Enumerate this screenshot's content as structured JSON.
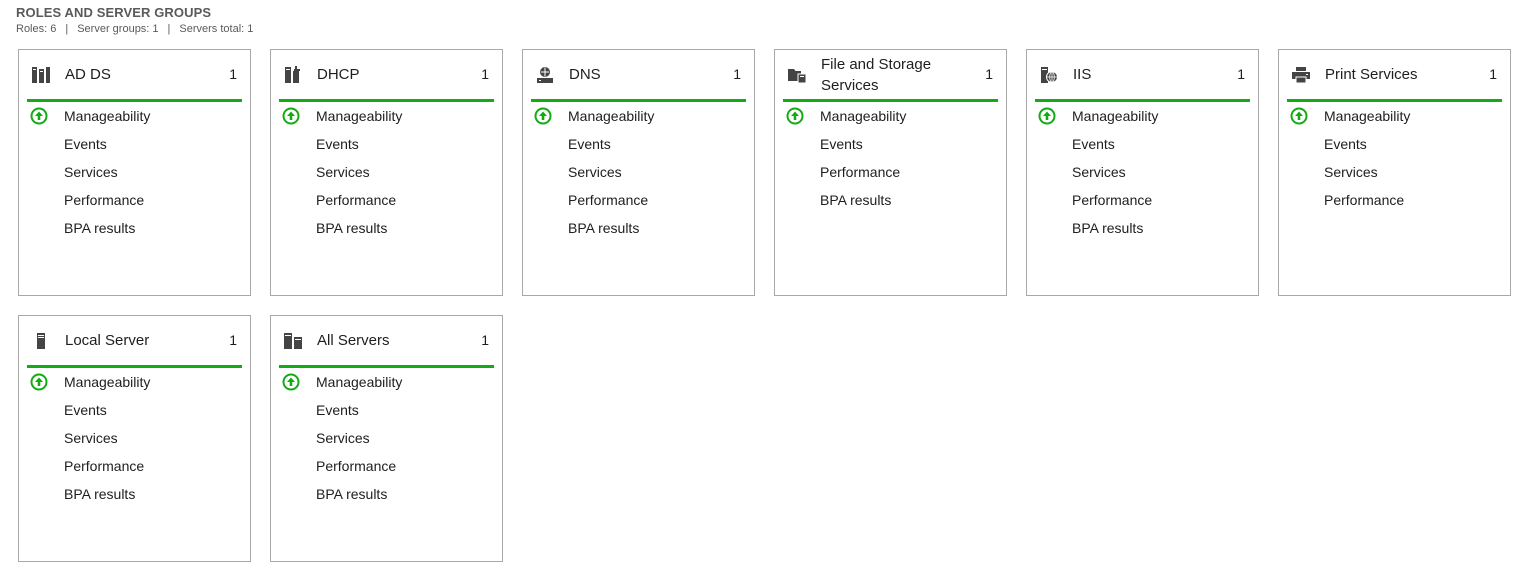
{
  "section": {
    "title": "ROLES AND SERVER GROUPS",
    "stats": {
      "roles": "Roles: 6",
      "groups": "Server groups: 1",
      "servers": "Servers total: 1",
      "separator": "|"
    }
  },
  "colors": {
    "accent_green": "#13ab13",
    "border": "#a9a9a9",
    "icon_gray": "#444444"
  },
  "tiles": [
    {
      "title": "AD DS",
      "count": "1",
      "icon": "ad-ds-icon",
      "items": [
        "Manageability",
        "Events",
        "Services",
        "Performance",
        "BPA results"
      ]
    },
    {
      "title": "DHCP",
      "count": "1",
      "icon": "dhcp-icon",
      "items": [
        "Manageability",
        "Events",
        "Services",
        "Performance",
        "BPA results"
      ]
    },
    {
      "title": "DNS",
      "count": "1",
      "icon": "dns-icon",
      "items": [
        "Manageability",
        "Events",
        "Services",
        "Performance",
        "BPA results"
      ]
    },
    {
      "title": "File and Storage Services",
      "count": "1",
      "icon": "file-storage-icon",
      "items": [
        "Manageability",
        "Events",
        "Performance",
        "BPA results"
      ]
    },
    {
      "title": "IIS",
      "count": "1",
      "icon": "iis-icon",
      "items": [
        "Manageability",
        "Events",
        "Services",
        "Performance",
        "BPA results"
      ]
    },
    {
      "title": "Print Services",
      "count": "1",
      "icon": "printer-icon",
      "items": [
        "Manageability",
        "Events",
        "Services",
        "Performance"
      ]
    },
    {
      "title": "Local Server",
      "count": "1",
      "icon": "local-server-icon",
      "items": [
        "Manageability",
        "Events",
        "Services",
        "Performance",
        "BPA results"
      ]
    },
    {
      "title": "All Servers",
      "count": "1",
      "icon": "all-servers-icon",
      "items": [
        "Manageability",
        "Events",
        "Services",
        "Performance",
        "BPA results"
      ]
    }
  ]
}
